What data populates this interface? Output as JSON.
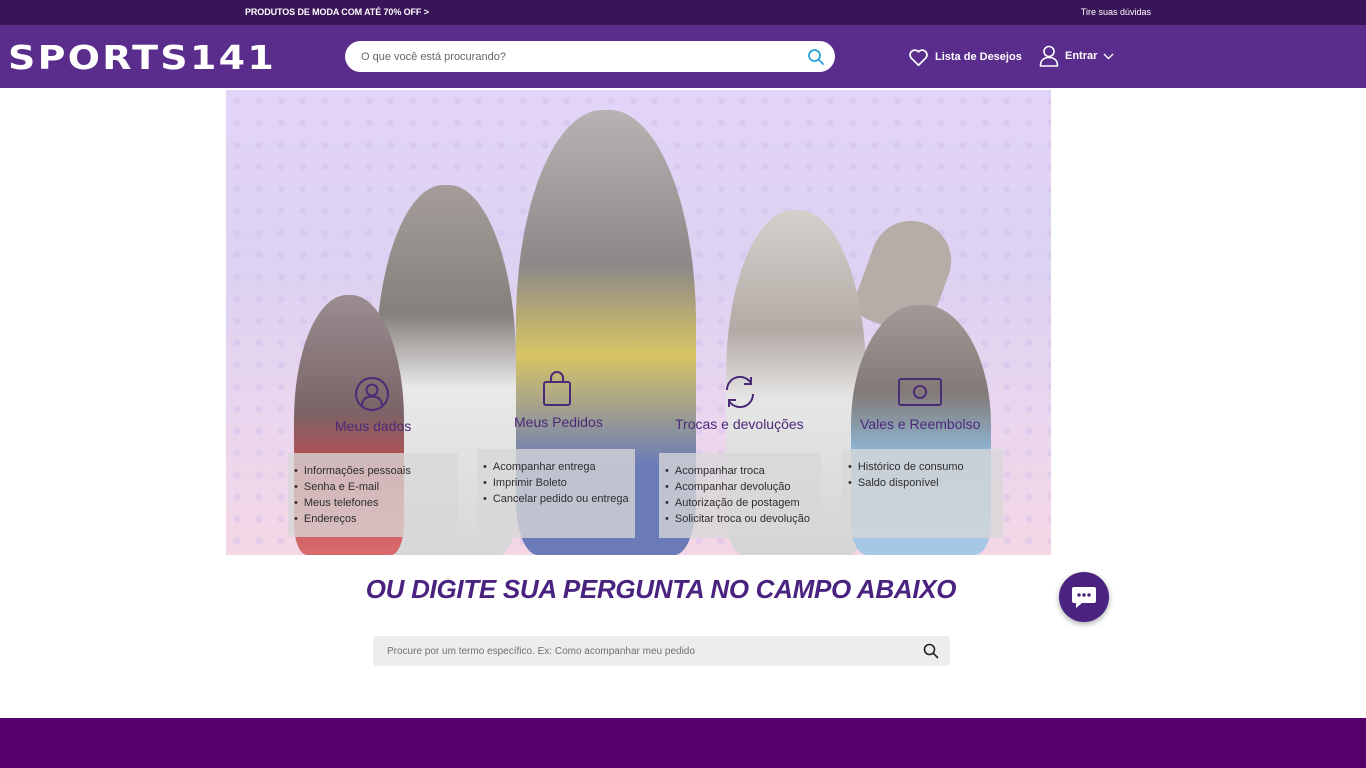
{
  "promo": {
    "left_text": "PRODUTOS DE MODA COM ATÉ 70% OFF >",
    "right_text": "Tire suas dúvidas"
  },
  "header": {
    "logo": "SPORTS141",
    "search_placeholder": "O que você está procurando?",
    "wishlist_label": "Lista de Desejos",
    "login_label": "Entrar",
    "bg_color": "#5a2d8c",
    "promo_bg_color": "#3a1458"
  },
  "categories": [
    {
      "title": "Meus dados",
      "icon": "user-circle-icon",
      "items": [
        "Informações pessoais",
        "Senha e E-mail",
        "Meus telefones",
        "Endereços"
      ]
    },
    {
      "title": "Meus Pedidos",
      "icon": "shopping-bag-icon",
      "items": [
        "Acompanhar entrega",
        "Imprimir Boleto",
        "Cancelar pedido ou entrega"
      ]
    },
    {
      "title": "Trocas e devoluções",
      "icon": "refresh-icon",
      "items": [
        "Acompanhar troca",
        "Acompanhar devolução",
        "Autorização de postagem",
        "Solicitar troca ou devolução"
      ]
    },
    {
      "title": "Vales e Reembolso",
      "icon": "money-bill-icon",
      "items": [
        "Histórico de consumo",
        "Saldo disponível"
      ]
    }
  ],
  "question": {
    "heading": "OU DIGITE SUA PERGUNTA NO CAMPO ABAIXO",
    "search_placeholder": "Procure por um termo específico. Ex: Como acompanhar meu pedido"
  },
  "colors": {
    "accent": "#4a2380",
    "footer": "#55006a"
  }
}
